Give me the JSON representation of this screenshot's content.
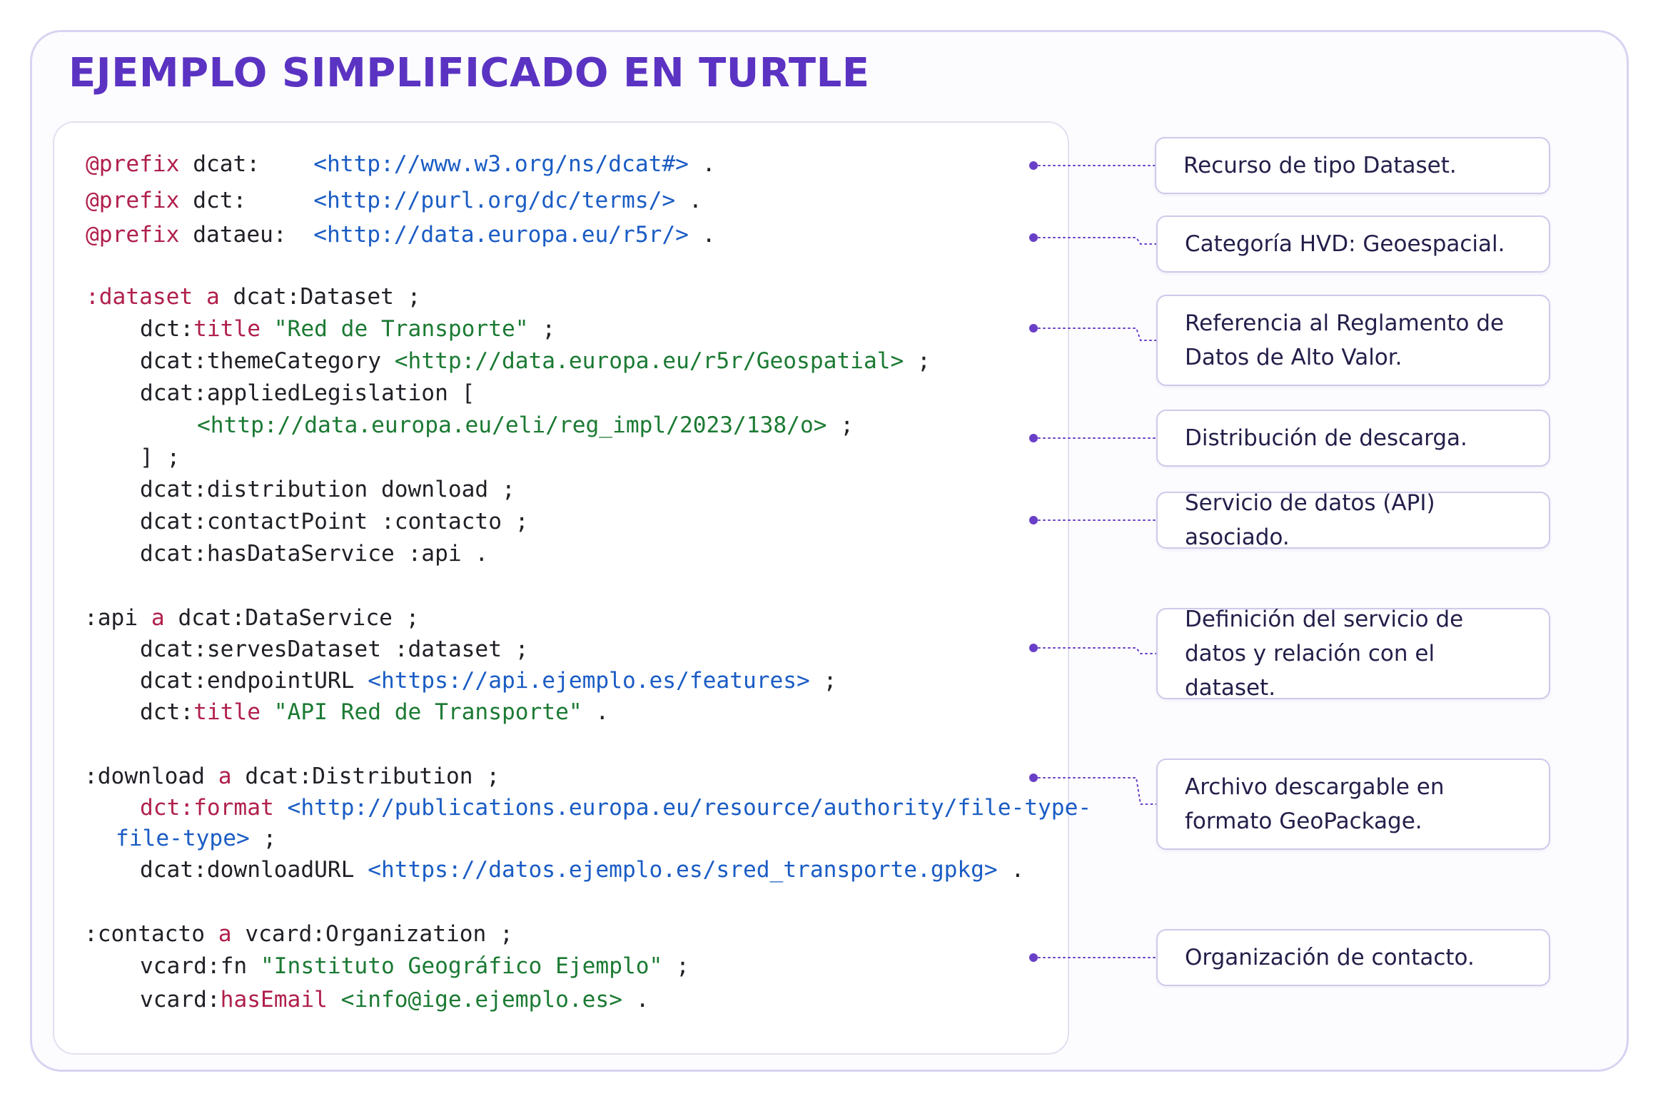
{
  "title": "EJEMPLO SIMPLIFICADO EN TURTLE",
  "colors": {
    "title": "#5b33c2",
    "frame_border": "#d8d3f1",
    "keyword": "#b0204c",
    "uri": "#1a5cc4",
    "string": "#1b7a33",
    "default_text": "#1f1f26",
    "connector": "#6a3fc7",
    "note_border": "#cfc9ea",
    "note_text": "#231f4a"
  },
  "code_lines": [
    [
      {
        "t": "@prefix",
        "k": "kw"
      },
      {
        "t": " dcat:    ",
        "k": "ns"
      },
      {
        "t": "<http://www.w3.org/ns/dcat#>",
        "k": "uri"
      },
      {
        "t": " .",
        "k": "p"
      }
    ],
    [
      {
        "t": "@prefix",
        "k": "kw"
      },
      {
        "t": " dct:     ",
        "k": "ns"
      },
      {
        "t": "<http://purl.org/dc/terms/>",
        "k": "uri"
      },
      {
        "t": " .",
        "k": "p"
      }
    ],
    [
      {
        "t": "@prefix",
        "k": "kw"
      },
      {
        "t": " dataeu:  ",
        "k": "ns"
      },
      {
        "t": "<http://data.europa.eu/r5r/>",
        "k": "uri"
      },
      {
        "t": " .",
        "k": "p"
      }
    ],
    [
      {
        "t": ":dataset",
        "k": "kw"
      },
      {
        "t": " a",
        "k": "kw"
      },
      {
        "t": " dcat:Dataset ;",
        "k": "ns"
      }
    ],
    [
      {
        "t": "dct:",
        "k": "ns"
      },
      {
        "t": "title",
        "k": "kw"
      },
      {
        "t": " ",
        "k": "p"
      },
      {
        "t": "\"Red de Transporte\"",
        "k": "str"
      },
      {
        "t": " ;",
        "k": "p"
      }
    ],
    [
      {
        "t": "dcat:themeCategory ",
        "k": "ns"
      },
      {
        "t": "<http://data.europa.eu/r5r/Geospatial>",
        "k": "str"
      },
      {
        "t": " ;",
        "k": "p"
      }
    ],
    [
      {
        "t": "dcat:appliedLegislation [",
        "k": "ns"
      }
    ],
    [
      {
        "t": "<http://data.europa.eu/eli/reg_impl/2023/138/o>",
        "k": "str"
      },
      {
        "t": " ;",
        "k": "p"
      }
    ],
    [
      {
        "t": "] ;",
        "k": "p"
      }
    ],
    [
      {
        "t": "dcat:distribution download ;",
        "k": "ns"
      }
    ],
    [
      {
        "t": "dcat:contactPoint :contacto ;",
        "k": "ns"
      }
    ],
    [
      {
        "t": "dcat:hasDataService :api .",
        "k": "ns"
      }
    ],
    [
      {
        "t": ":api",
        "k": "ns"
      },
      {
        "t": " a",
        "k": "kw"
      },
      {
        "t": " dcat:DataService ;",
        "k": "ns"
      }
    ],
    [
      {
        "t": "dcat:servesDataset :dataset ;",
        "k": "ns"
      }
    ],
    [
      {
        "t": "dcat:endpointURL ",
        "k": "ns"
      },
      {
        "t": "<https://api.ejemplo.es/features>",
        "k": "uri"
      },
      {
        "t": " ;",
        "k": "p"
      }
    ],
    [
      {
        "t": "dct:",
        "k": "ns"
      },
      {
        "t": "title",
        "k": "kw"
      },
      {
        "t": " ",
        "k": "p"
      },
      {
        "t": "\"API Red de Transporte\"",
        "k": "str"
      },
      {
        "t": " .",
        "k": "p"
      }
    ],
    [
      {
        "t": ":download",
        "k": "ns"
      },
      {
        "t": " a",
        "k": "kw"
      },
      {
        "t": " dcat:Distribution ;",
        "k": "ns"
      }
    ],
    [
      {
        "t": "dct:format",
        "k": "kw"
      },
      {
        "t": " ",
        "k": "p"
      },
      {
        "t": "<http://publications.europa.eu/resource/authority/file-type-",
        "k": "uri"
      }
    ],
    [
      {
        "t": "file-type>",
        "k": "uri"
      },
      {
        "t": " ;",
        "k": "p"
      }
    ],
    [
      {
        "t": "dcat:downloadURL ",
        "k": "ns"
      },
      {
        "t": "<https://datos.ejemplo.es/sred_transporte.gpkg>",
        "k": "uri"
      },
      {
        "t": " .",
        "k": "p"
      }
    ],
    [
      {
        "t": ":contacto",
        "k": "ns"
      },
      {
        "t": " a",
        "k": "kw"
      },
      {
        "t": " vcard:Organization ;",
        "k": "ns"
      }
    ],
    [
      {
        "t": "vcard:fn ",
        "k": "ns"
      },
      {
        "t": "\"Instituto Geográfico Ejemplo\"",
        "k": "str"
      },
      {
        "t": " ;",
        "k": "p"
      }
    ],
    [
      {
        "t": "vcard:",
        "k": "ns"
      },
      {
        "t": "hasEmail",
        "k": "kw"
      },
      {
        "t": " ",
        "k": "p"
      },
      {
        "t": "<info@ige.ejemplo.es>",
        "k": "str"
      },
      {
        "t": " .",
        "k": "p"
      }
    ]
  ],
  "annotations": [
    "Recurso de tipo Dataset.",
    "Categoría HVD: Geoespacial.",
    "Referencia al Reglamento de Datos de Alto Valor.",
    "Distribución de descarga.",
    "Servicio de datos (API) asociado.",
    "Definición del servicio de datos y relación con el dataset.",
    "Archivo descargable en formato GeoPackage.",
    "Organización de contacto."
  ]
}
